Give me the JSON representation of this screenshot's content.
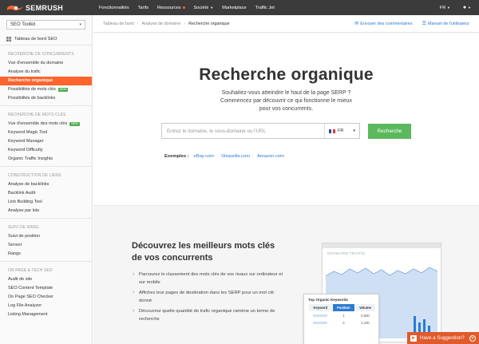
{
  "brand": {
    "name": "SEMRUSH",
    "accent": "#ff642d",
    "link": "#2d7bd1",
    "success": "#5cb85c"
  },
  "topnav": {
    "items": [
      {
        "label": "Fonctionnalités"
      },
      {
        "label": "Tarifs"
      },
      {
        "label": "Ressources"
      },
      {
        "label": "Société"
      },
      {
        "label": "Marketplace"
      },
      {
        "label": "Traffic Jet"
      }
    ],
    "language": "FR",
    "user_icon": "user-icon"
  },
  "sidebar": {
    "toolkit": "SEO Toolkit",
    "dashboard": "Tableau de bord SEO",
    "sections": [
      {
        "title": "RECHERCHE DE CONCURRENTS",
        "items": [
          {
            "label": "Vue d'ensemble du domaine"
          },
          {
            "label": "Analyse du trafic"
          },
          {
            "label": "Recherche organique"
          },
          {
            "label": "Possibilités de mots clés",
            "badge": "NEW"
          },
          {
            "label": "Possibilités de backlinks"
          }
        ]
      },
      {
        "title": "RECHERCHE DE MOTS CLÉS",
        "items": [
          {
            "label": "Vue d'ensemble des mots clés",
            "badge": "NEW"
          },
          {
            "label": "Keyword Magic Tool"
          },
          {
            "label": "Keyword Manager"
          },
          {
            "label": "Keyword Difficulty"
          },
          {
            "label": "Organic Traffic Insights"
          }
        ]
      },
      {
        "title": "CONSTRUCTION DE LIENS",
        "items": [
          {
            "label": "Analyse de backlinks"
          },
          {
            "label": "Backlink Audit"
          },
          {
            "label": "Link Building Tool"
          },
          {
            "label": "Analyse par lots"
          }
        ]
      },
      {
        "title": "SUIVI DE RANG",
        "items": [
          {
            "label": "Suivi de position"
          },
          {
            "label": "Sensor"
          },
          {
            "label": "Rangs"
          }
        ]
      },
      {
        "title": "ON PAGE & TECH SEO",
        "items": [
          {
            "label": "Audit de site"
          },
          {
            "label": "SEO Content Template"
          },
          {
            "label": "On Page SEO Checker"
          },
          {
            "label": "Log File Analyzer"
          },
          {
            "label": "Listing Management"
          }
        ]
      }
    ]
  },
  "breadcrumb": {
    "items": [
      "Tableau de bord",
      "Analyse de domaine",
      "Recherche organique"
    ],
    "feedback": "Envoyer des commentaires",
    "manual": "Manuel de l'utilisateur"
  },
  "hero": {
    "title": "Recherche organique",
    "subtitle_line1": "Souhaitez-vous atteindre le haut de la page SERP ?",
    "subtitle_line2": "Commencez par découvrir ce qui fonctionne le mieux",
    "subtitle_line3": "pour vos concurrents.",
    "search_placeholder": "Entrez le domaine, le sous-domaine ou l'URL",
    "database": "FR",
    "search_button": "Recherche",
    "examples_label": "Exemples :",
    "examples": [
      "eBay.com",
      "Shopzilla.com",
      "Amazon.com"
    ]
  },
  "lower": {
    "heading": "Découvrez les meilleurs mots clés de vos concurrents",
    "bullets": [
      "Parcourez le classement des mots clés de vos rivaux sur ordinateur et sur mobile",
      "Affichez leur pages de destination dans les SERP pour un mot clé donné",
      "Découvrez quelle quantité de trafic organique ramène un terme de recherche"
    ],
    "chart_title": "ESTIMATED TRAFFIC",
    "table_title": "Top Organic Keywords",
    "table_headers": [
      "Keyword",
      "Position",
      "Volume"
    ],
    "table_rows": [
      {
        "position": "1",
        "volume": "5,500"
      },
      {
        "position": "3",
        "volume": "2,100"
      }
    ]
  },
  "suggestion": {
    "label": "Have a Suggestion?"
  }
}
